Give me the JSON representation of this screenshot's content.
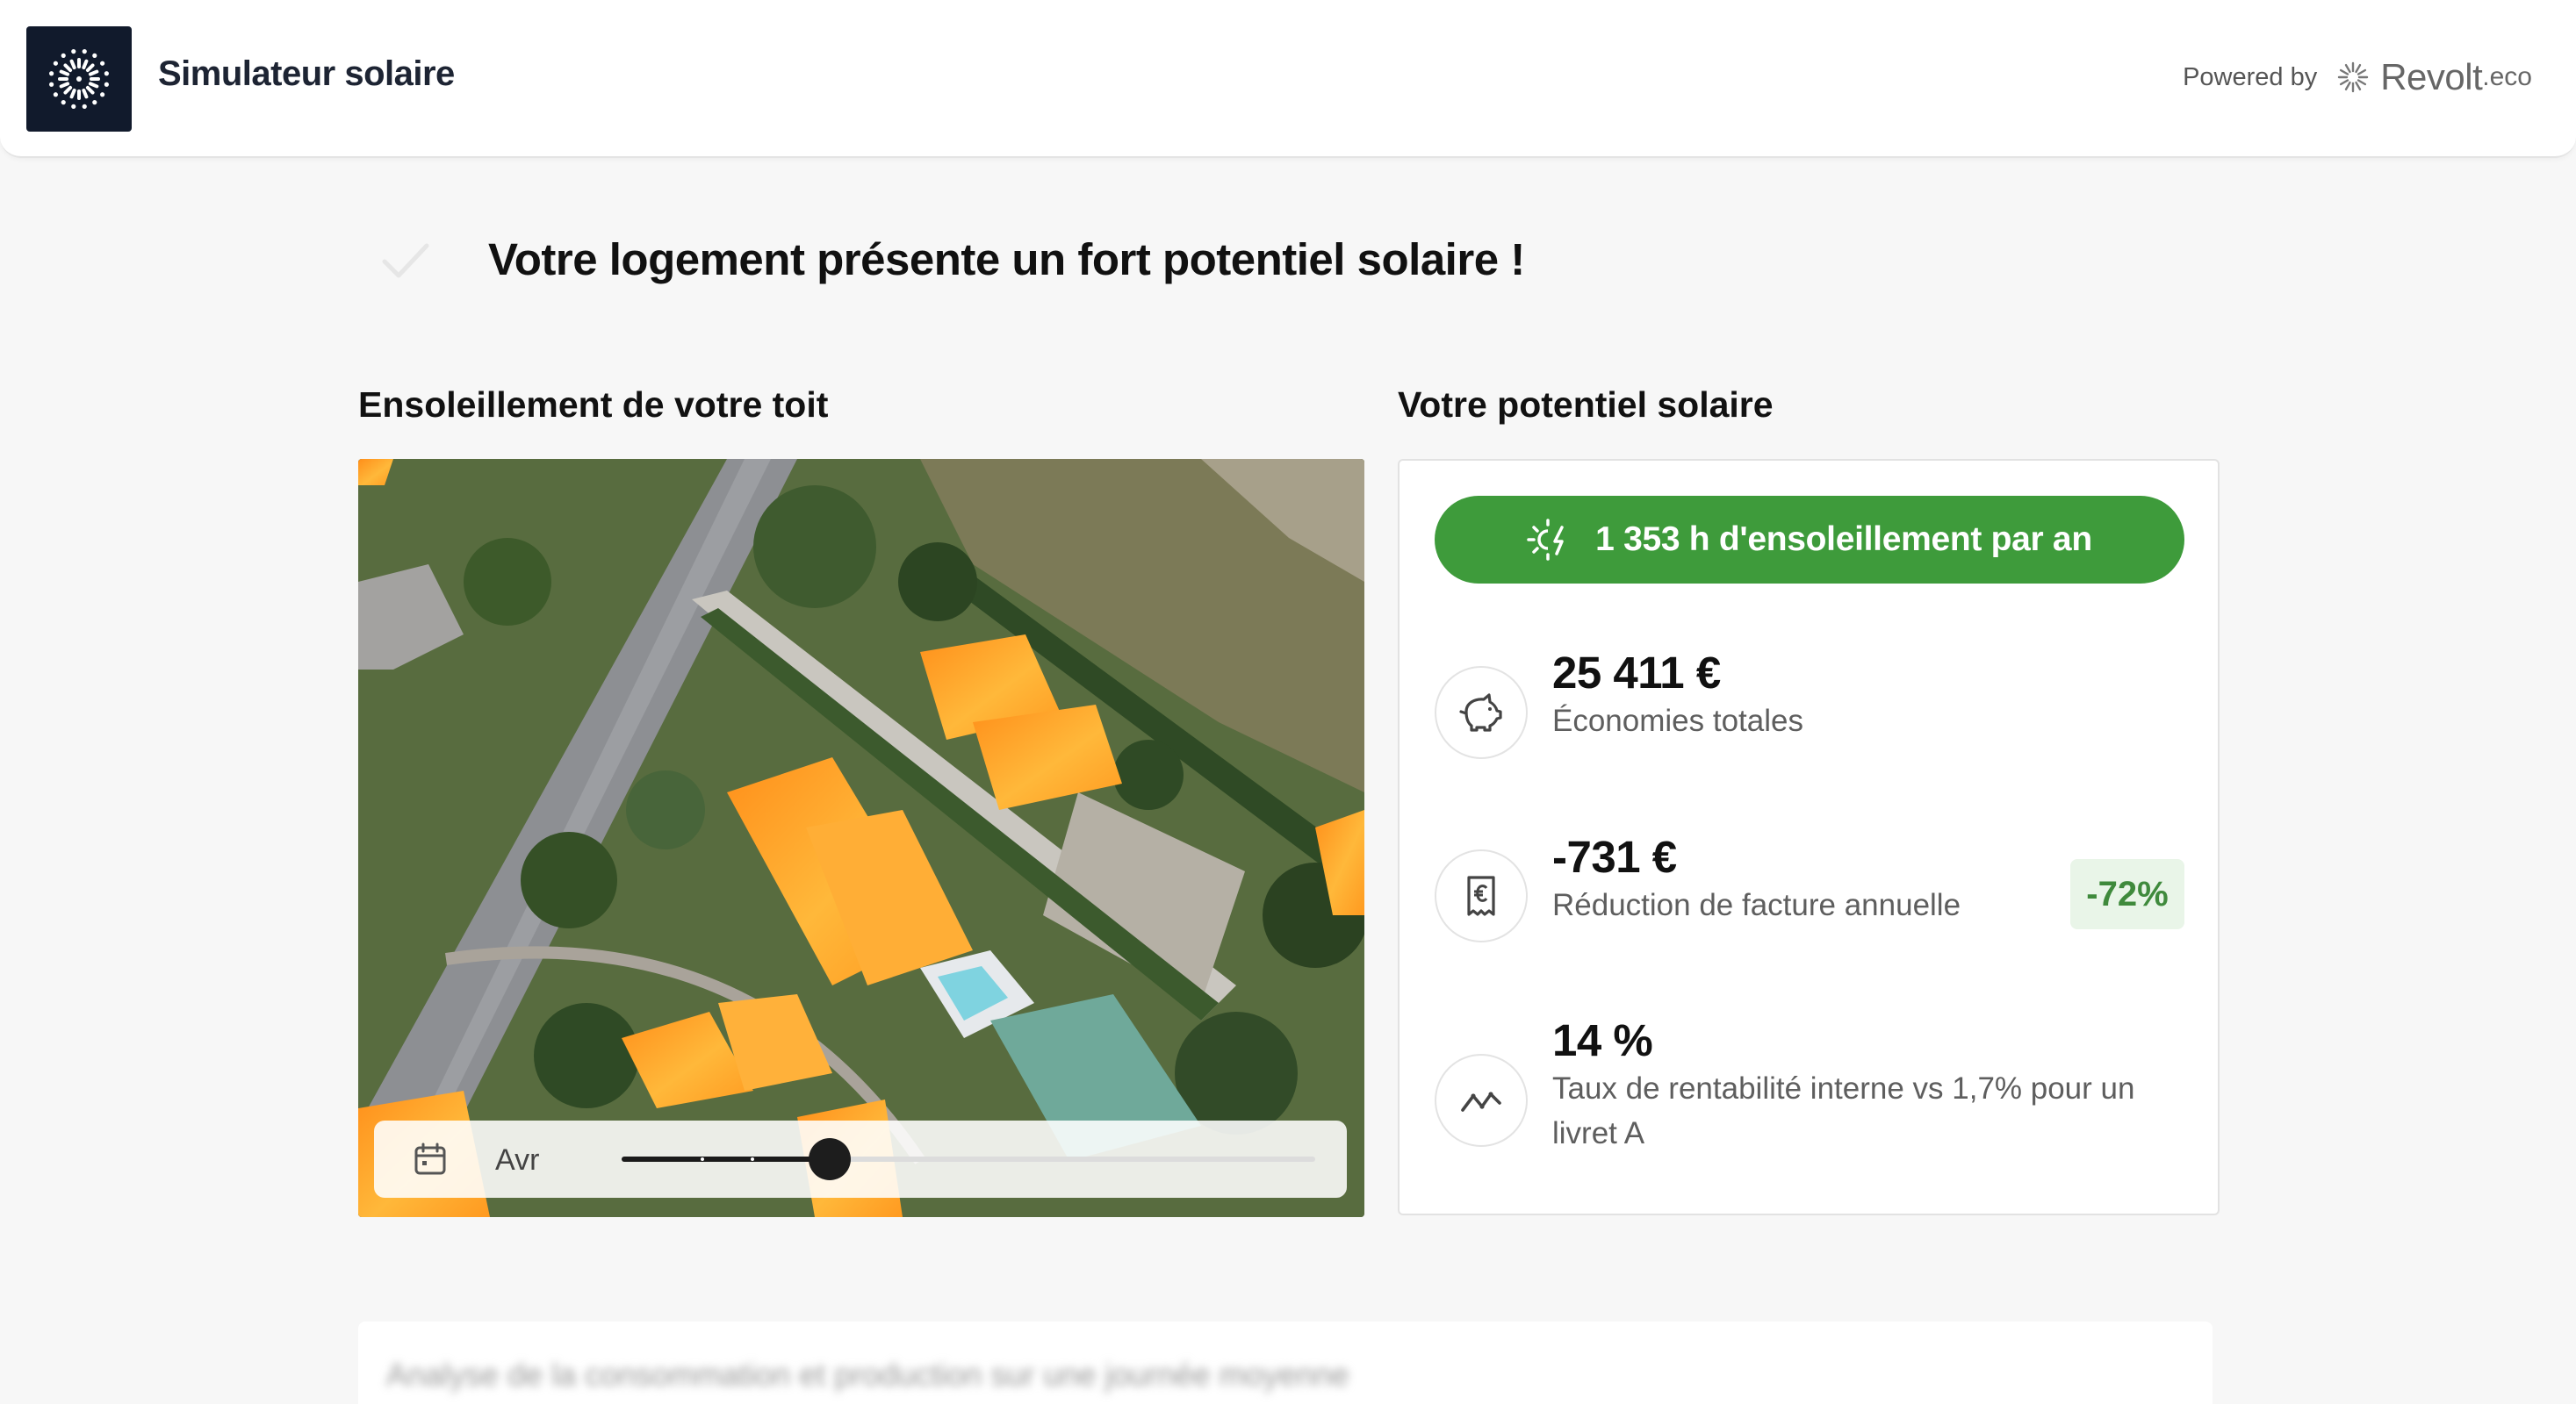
{
  "header": {
    "app_title": "Simulateur solaire",
    "powered_label": "Powered by",
    "brand_name": "Revolt",
    "brand_suffix": ".eco"
  },
  "banner": {
    "title": "Votre logement présente un fort potentiel solaire !"
  },
  "roof_section": {
    "title": "Ensoleillement de votre toit",
    "month_label": "Avr",
    "slider_position": 0.3
  },
  "potential_section": {
    "title": "Votre potentiel solaire",
    "sunshine_text": "1 353 h d'ensoleillement par an",
    "stats": [
      {
        "value": "25 411 €",
        "label": "Économies totales",
        "icon": "piggy-bank-icon"
      },
      {
        "value": "-731 €",
        "label": "Réduction de facture annuelle",
        "icon": "receipt-euro-icon",
        "badge": "-72%"
      },
      {
        "value": "14 %",
        "label": "Taux de rentabilité interne vs 1,7% pour un livret A",
        "icon": "trend-line-icon"
      }
    ]
  },
  "bottom_card": {
    "title": "Analyse de la consommation et production sur une journée moyenne"
  },
  "colors": {
    "accent_green": "#3e9b3b",
    "badge_text": "#3f8a3c",
    "badge_bg": "#e9f5e8",
    "logo_bg": "#111a2c"
  }
}
